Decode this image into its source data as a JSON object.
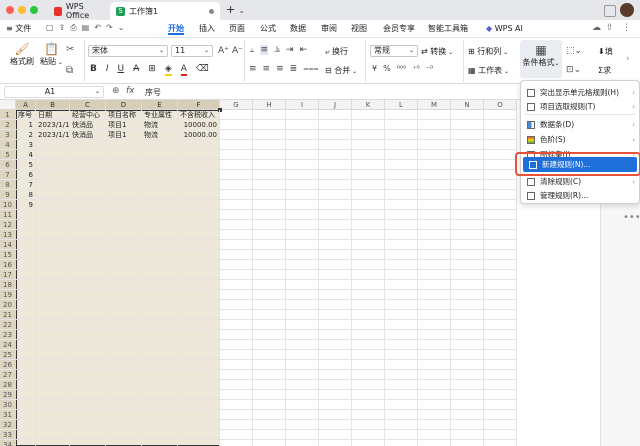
{
  "titlebar": {
    "tabs": [
      {
        "label": "WPS Office"
      },
      {
        "label": "工作簿1"
      }
    ],
    "add_label": "+"
  },
  "menubar": {
    "file": "文件",
    "items": [
      "开始",
      "插入",
      "页面",
      "公式",
      "数据",
      "审阅",
      "视图",
      "会员专享",
      "智能工具箱"
    ],
    "wps_ai": "WPS AI"
  },
  "ribbon": {
    "format_painter": "格式刷",
    "paste": "粘贴",
    "font_name": "宋体",
    "font_size": "11",
    "wrap": "换行",
    "merge": "合并",
    "number_format": "常规",
    "convert": "转换",
    "row_col": "行和列",
    "worksheet": "工作表",
    "cond_format": "条件格式",
    "fill": "填",
    "sum": "求"
  },
  "formula_bar": {
    "cell_ref": "A1",
    "fx": "fx",
    "content": "序号"
  },
  "sheet": {
    "columns": [
      "A",
      "B",
      "C",
      "D",
      "E",
      "F",
      "G",
      "H",
      "I",
      "J",
      "K",
      "L",
      "M",
      "N",
      "O"
    ],
    "header": [
      "序号",
      "日期",
      "经营中心",
      "项目名称",
      "专业属性",
      "不含税收入"
    ],
    "rows": [
      [
        "1",
        "2023/1/1",
        "快消品",
        "项目1",
        "物流",
        "10000.00"
      ],
      [
        "2",
        "2023/1/1",
        "快消品",
        "项目1",
        "物流",
        "10000.00"
      ],
      [
        "3",
        "",
        "",
        "",
        "",
        ""
      ],
      [
        "4",
        "",
        "",
        "",
        "",
        ""
      ],
      [
        "5",
        "",
        "",
        "",
        "",
        ""
      ],
      [
        "6",
        "",
        "",
        "",
        "",
        ""
      ],
      [
        "7",
        "",
        "",
        "",
        "",
        ""
      ],
      [
        "8",
        "",
        "",
        "",
        "",
        ""
      ],
      [
        "9",
        "",
        "",
        "",
        "",
        ""
      ]
    ],
    "row_numbers": [
      "1",
      "2",
      "3",
      "4",
      "5",
      "6",
      "7",
      "8",
      "9",
      "10",
      "11",
      "12",
      "13",
      "14",
      "15",
      "16",
      "17",
      "18",
      "19",
      "20",
      "21",
      "22",
      "23",
      "24",
      "25",
      "26",
      "27",
      "28",
      "29",
      "30",
      "31",
      "32",
      "33",
      "34"
    ]
  },
  "dropdown": {
    "items": [
      {
        "label": "突出显示单元格规则(H)",
        "arrow": "›"
      },
      {
        "label": "项目选取规则(T)",
        "arrow": "›"
      },
      {
        "label": "数据条(D)",
        "arrow": "›"
      },
      {
        "label": "色阶(S)",
        "arrow": "›"
      },
      {
        "label": "图标集(I)",
        "arrow": "›"
      },
      {
        "label": "新建规则(N)...",
        "arrow": ""
      },
      {
        "label": "清除规则(C)",
        "arrow": "›"
      },
      {
        "label": "管理规则(R)...",
        "arrow": ""
      }
    ]
  },
  "colors": {
    "accent": "#1e6fd9",
    "highlight_border": "#e8503a",
    "selected_col": "#d7ceb7",
    "selected_cells": "#ede8da",
    "tab_active": "#ffffff",
    "wps_red": "#e8322d",
    "sheet_green": "#1f9d55"
  }
}
